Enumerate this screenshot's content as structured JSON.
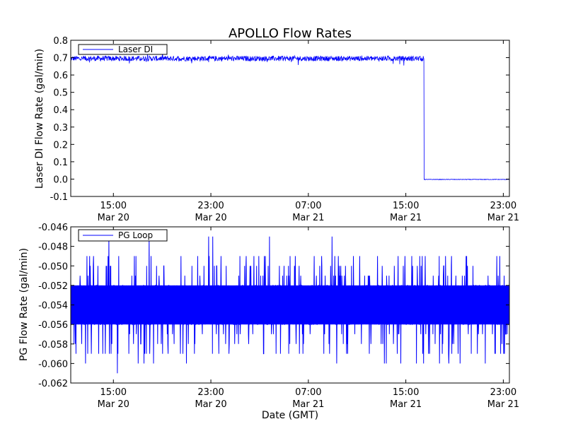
{
  "figure": {
    "title": "APOLLO Flow Rates"
  },
  "chart_data": [
    {
      "type": "line",
      "title": "APOLLO Flow Rates",
      "ylabel": "Laser DI Flow Rate (gal/min)",
      "xlabel": "",
      "ylim": [
        -0.1,
        0.8
      ],
      "xlim": [
        "2014-03-20 11:30",
        "2014-03-21 23:30"
      ],
      "yticks": [
        "-0.1",
        "0.0",
        "0.1",
        "0.2",
        "0.3",
        "0.4",
        "0.5",
        "0.6",
        "0.7",
        "0.8"
      ],
      "xticks": [
        {
          "time": "15:00",
          "date": "Mar 20"
        },
        {
          "time": "23:00",
          "date": "Mar 20"
        },
        {
          "time": "07:00",
          "date": "Mar 21"
        },
        {
          "time": "15:00",
          "date": "Mar 21"
        },
        {
          "time": "23:00",
          "date": "Mar 21"
        }
      ],
      "legend": "top-left",
      "color": "#0000ff",
      "series": [
        {
          "name": "Laser DI",
          "description": "noisy around 0.70 from start until ~Mar 21 16:30, then drops to ~0.0",
          "points": [
            [
              "Mar 20 11:30",
              0.69
            ],
            [
              "Mar 20 12:30",
              0.7
            ],
            [
              "Mar 20 15:00",
              0.7
            ],
            [
              "Mar 20 19:00",
              0.7
            ],
            [
              "Mar 20 23:00",
              0.69
            ],
            [
              "Mar 21 03:00",
              0.69
            ],
            [
              "Mar 21 07:00",
              0.7
            ],
            [
              "Mar 21 11:00",
              0.69
            ],
            [
              "Mar 21 15:00",
              0.7
            ],
            [
              "Mar 21 16:30",
              0.69
            ],
            [
              "Mar 21 16:35",
              0.0
            ],
            [
              "Mar 21 20:00",
              -0.002
            ],
            [
              "Mar 21 23:30",
              -0.003
            ]
          ]
        }
      ]
    },
    {
      "type": "line",
      "title": "",
      "ylabel": "PG Flow Rate (gal/min)",
      "xlabel": "Date (GMT)",
      "ylim": [
        -0.062,
        -0.046
      ],
      "xlim": [
        "2014-03-20 11:30",
        "2014-03-21 23:30"
      ],
      "yticks": [
        "-0.062",
        "-0.060",
        "-0.058",
        "-0.056",
        "-0.054",
        "-0.052",
        "-0.050",
        "-0.048",
        "-0.046"
      ],
      "xticks": [
        {
          "time": "15:00",
          "date": "Mar 20"
        },
        {
          "time": "23:00",
          "date": "Mar 20"
        },
        {
          "time": "07:00",
          "date": "Mar 21"
        },
        {
          "time": "15:00",
          "date": "Mar 21"
        },
        {
          "time": "23:00",
          "date": "Mar 21"
        }
      ],
      "legend": "top-left",
      "color": "#0000ff",
      "series": [
        {
          "name": "PG Loop",
          "description": "dense noise band between -0.056 and -0.052 with spikes up to -0.047 and down to -0.061",
          "points": [
            [
              "Mar 20 11:30",
              -0.054
            ],
            [
              "Mar 20 15:00",
              -0.054
            ],
            [
              "Mar 20 23:00",
              -0.054
            ],
            [
              "Mar 21 07:00",
              -0.054
            ],
            [
              "Mar 21 15:00",
              -0.054
            ],
            [
              "Mar 21 23:30",
              -0.054
            ]
          ],
          "band": [
            -0.056,
            -0.052
          ],
          "max": -0.047,
          "min": -0.061
        }
      ]
    }
  ]
}
